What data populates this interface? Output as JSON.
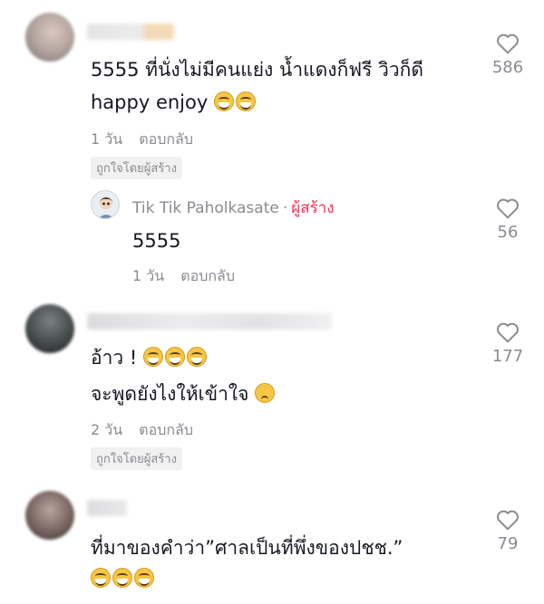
{
  "comments": [
    {
      "text_line1": "5555 ที่นั่งไม่มีคนแย่ง น้ำแดงก็ฟรี วิวก็ดี",
      "text_line2": "happy enjoy",
      "time": "1 วัน",
      "reply": "ตอบกลับ",
      "badge": "ถูกใจโดยผู้สร้าง",
      "likes": "586"
    },
    {
      "author": "Tik Tik Paholkasate",
      "separator": "·",
      "creator_tag": "ผู้สร้าง",
      "text_line1": "5555",
      "time": "1 วัน",
      "reply": "ตอบกลับ",
      "likes": "56"
    },
    {
      "text_line1": "อ้าว !",
      "text_line2": "จะพูดยังไงให้เข้าใจ",
      "time": "2 วัน",
      "reply": "ตอบกลับ",
      "badge": "ถูกใจโดยผู้สร้าง",
      "likes": "177"
    },
    {
      "text_line1": "ที่มาของคำว่า”ศาลเป็นที่พึ่งของปชช.”",
      "likes": "79"
    }
  ],
  "colors": {
    "accent": "#fe2c55",
    "muted": "#8a8b91",
    "text": "#161823"
  },
  "icons": [
    "heart-outline-icon",
    "laughing-emoji-icon",
    "pleading-emoji-icon"
  ]
}
